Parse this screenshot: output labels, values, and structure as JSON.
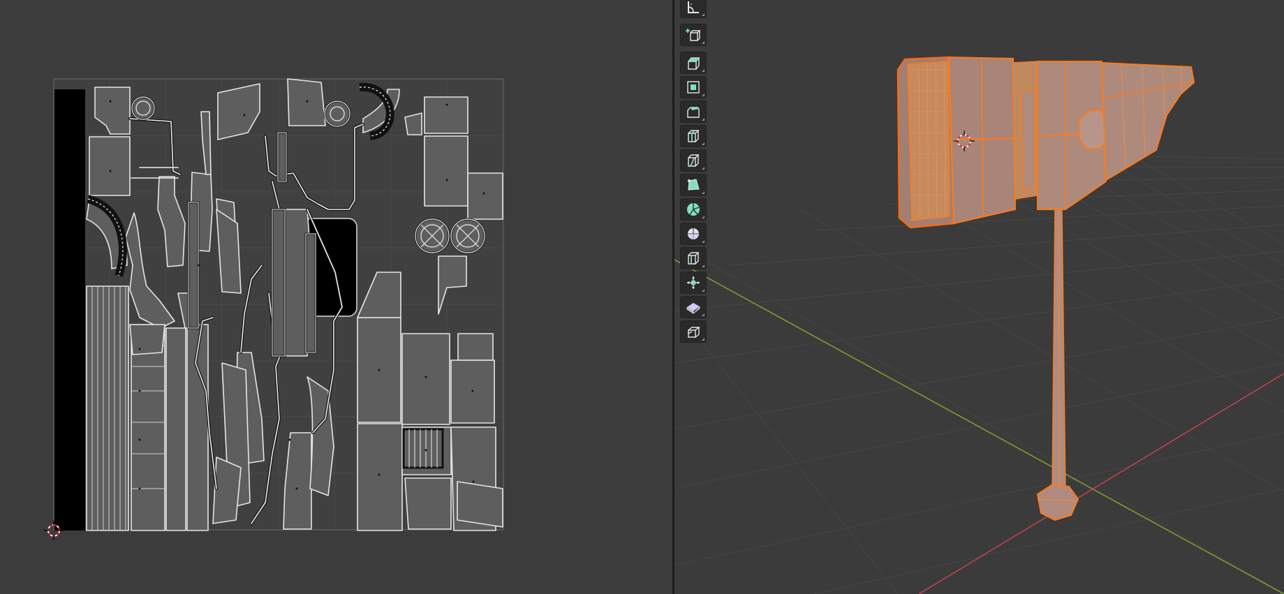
{
  "app": {
    "editors": [
      "uv-editor",
      "3d-viewport"
    ]
  },
  "colors": {
    "background": "#3c3c3c",
    "uv_grid": "#5a5a5a",
    "uv_island_fill": "#5c5c5c",
    "uv_edge": "#e8e8e8",
    "selection": "#ff7a1a",
    "axis_x": "#c8414f",
    "axis_y": "#7fa52b",
    "tool_accent": "#7fe0c0"
  },
  "toolbar": {
    "tools": [
      "measure-tool-icon",
      "add-cube-icon",
      "extrude-region-icon",
      "inset-faces-icon",
      "bevel-icon",
      "loop-cut-icon",
      "knife-icon",
      "poly-build-icon",
      "spin-icon",
      "smooth-icon",
      "edge-slide-icon",
      "shrink-fatten-icon",
      "shear-icon",
      "rip-region-icon"
    ]
  }
}
